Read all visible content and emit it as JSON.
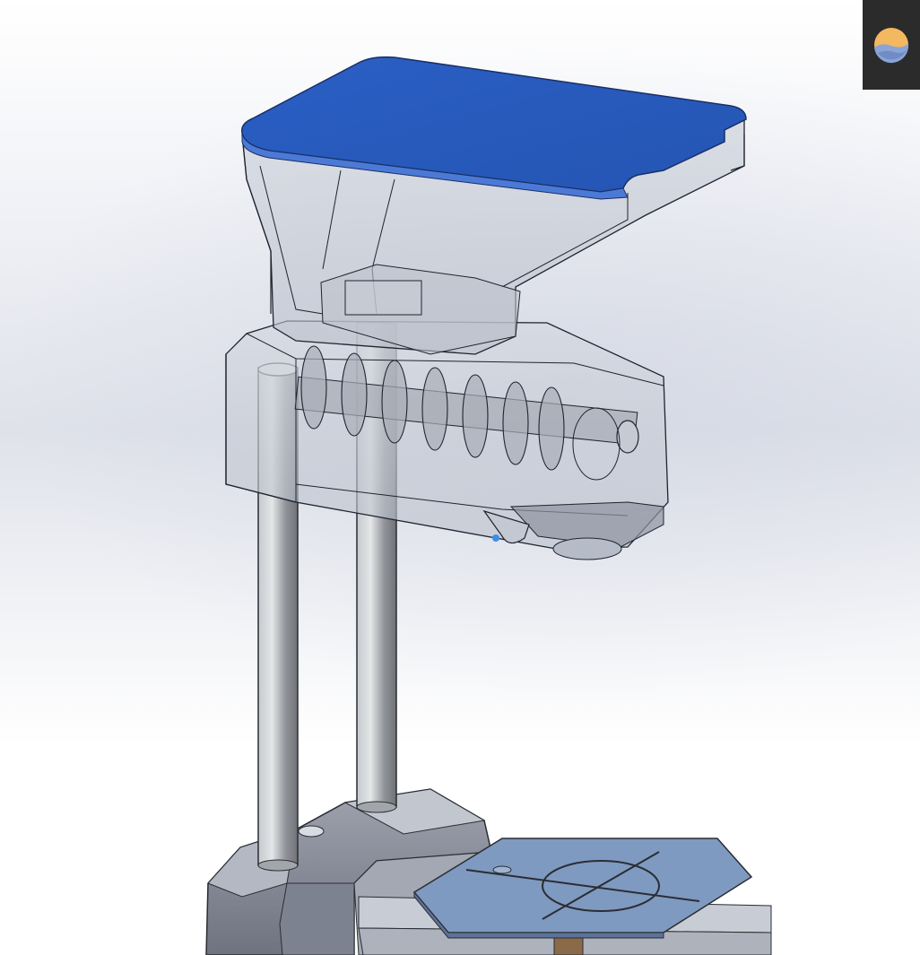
{
  "viewport": {
    "kind": "3d-cad-model-view",
    "background": "#ffffff",
    "model_colors": {
      "lid_blue": "#2a5dbe",
      "glass_line": "#1f2430",
      "glass_fill": "#c9ced8",
      "rod_metal": "#9ea1a6",
      "base_gray": "#8a8e9a",
      "plate_blue": "#7f9ac0",
      "accent_selection": "#3a8ee6"
    }
  },
  "corner_widget": {
    "icon": "sun-moon-icon",
    "background": "#2b2b2b"
  }
}
